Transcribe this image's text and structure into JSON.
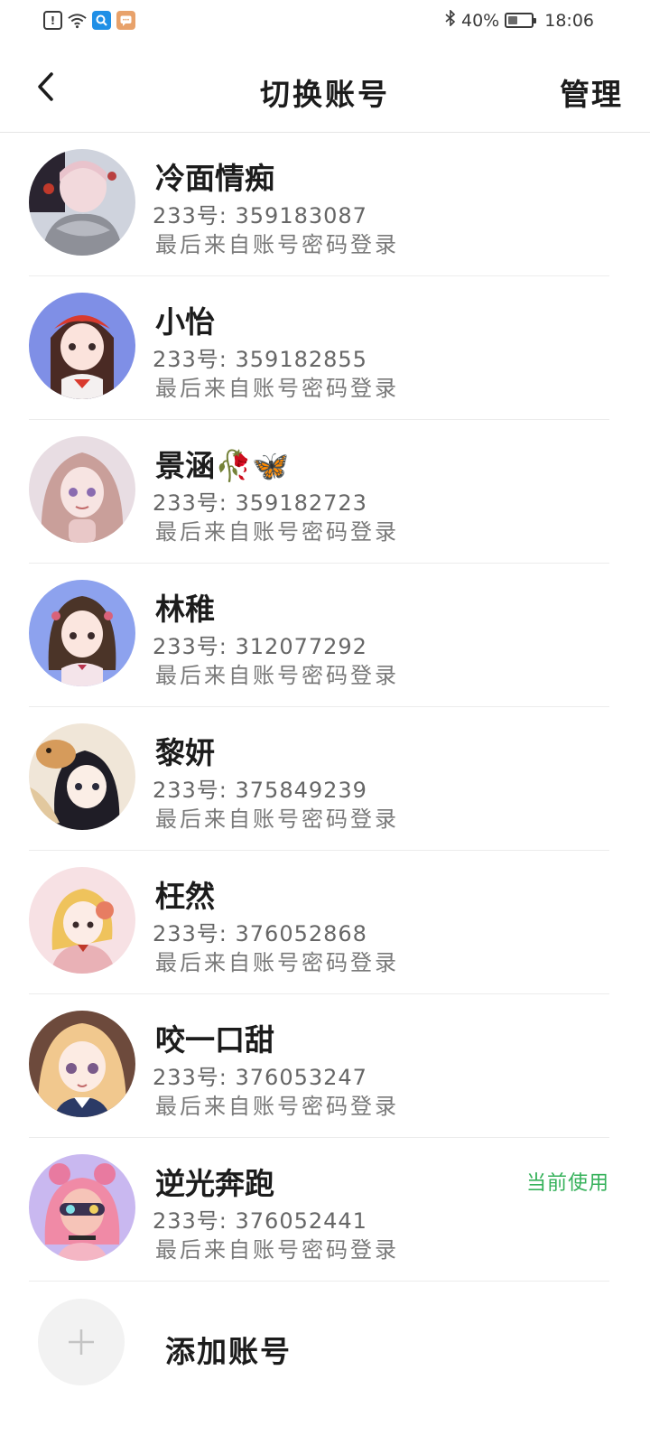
{
  "status_bar": {
    "icons": [
      "alert-icon",
      "wifi-icon",
      "search-app-icon",
      "chat-app-icon"
    ],
    "bluetooth_icon": "bluetooth-icon",
    "battery_percent_text": "40%",
    "battery_level": 0.4,
    "time": "18:06"
  },
  "header": {
    "back_icon": "chevron-left-icon",
    "title": "切换账号",
    "manage_label": "管理"
  },
  "accounts": [
    {
      "name": "冷面情痴",
      "id_text": "233号: 359183087",
      "login_text": "最后来自账号密码登录",
      "current": ""
    },
    {
      "name": "小怡",
      "id_text": "233号: 359182855",
      "login_text": "最后来自账号密码登录",
      "current": ""
    },
    {
      "name": "景涵🥀🦋",
      "id_text": "233号: 359182723",
      "login_text": "最后来自账号密码登录",
      "current": ""
    },
    {
      "name": "林稚",
      "id_text": "233号: 312077292",
      "login_text": "最后来自账号密码登录",
      "current": ""
    },
    {
      "name": "黎妍",
      "id_text": "233号: 375849239",
      "login_text": "最后来自账号密码登录",
      "current": ""
    },
    {
      "name": "枉然",
      "id_text": "233号: 376052868",
      "login_text": "最后来自账号密码登录",
      "current": ""
    },
    {
      "name": "咬一口甜",
      "id_text": "233号: 376053247",
      "login_text": "最后来自账号密码登录",
      "current": ""
    },
    {
      "name": "逆光奔跑",
      "id_text": "233号: 376052441",
      "login_text": "最后来自账号密码登录",
      "current": "当前使用"
    }
  ],
  "add_account": {
    "icon": "plus-icon",
    "label": "添加账号"
  },
  "colors": {
    "current_badge": "#35b15a",
    "secondary_text": "#7a7a7a",
    "divider": "#ececec"
  }
}
